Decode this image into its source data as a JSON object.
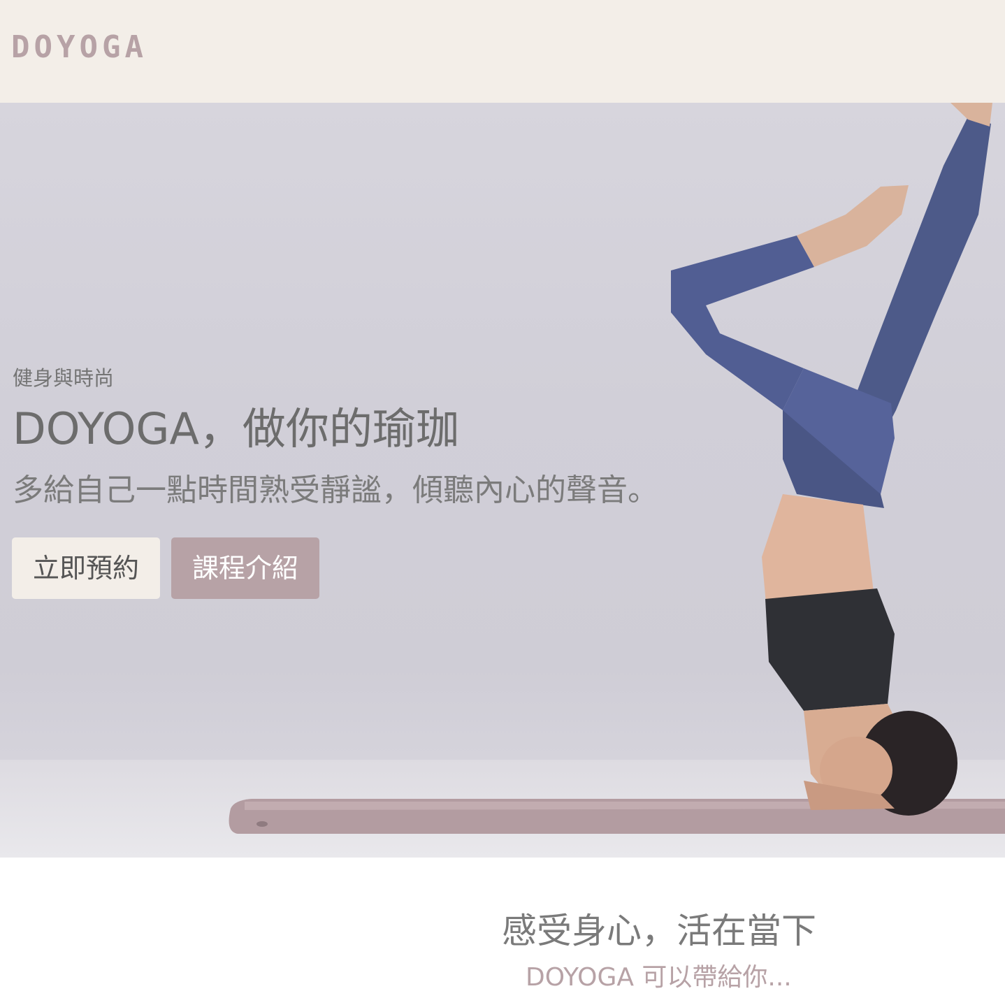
{
  "brand": {
    "logo_text": "DOYOGA"
  },
  "hero": {
    "eyebrow": "健身與時尚",
    "headline": "DOYOGA，做你的瑜珈",
    "subheadline": "多給自己一點時間熟受靜謐，傾聽內心的聲音。",
    "primary_button_label": "立即預約",
    "secondary_button_label": "課程介紹"
  },
  "feature": {
    "title": "感受身心，活在當下",
    "subtitle": "DOYOGA 可以帶給你..."
  },
  "colors": {
    "header_bg": "#f3eee8",
    "accent": "#b7a2a6",
    "text_gray": "#6c6c6c",
    "hero_bg": "#d3d1da"
  },
  "icons": {
    "hero_image": "yoga-headstand-photo"
  }
}
